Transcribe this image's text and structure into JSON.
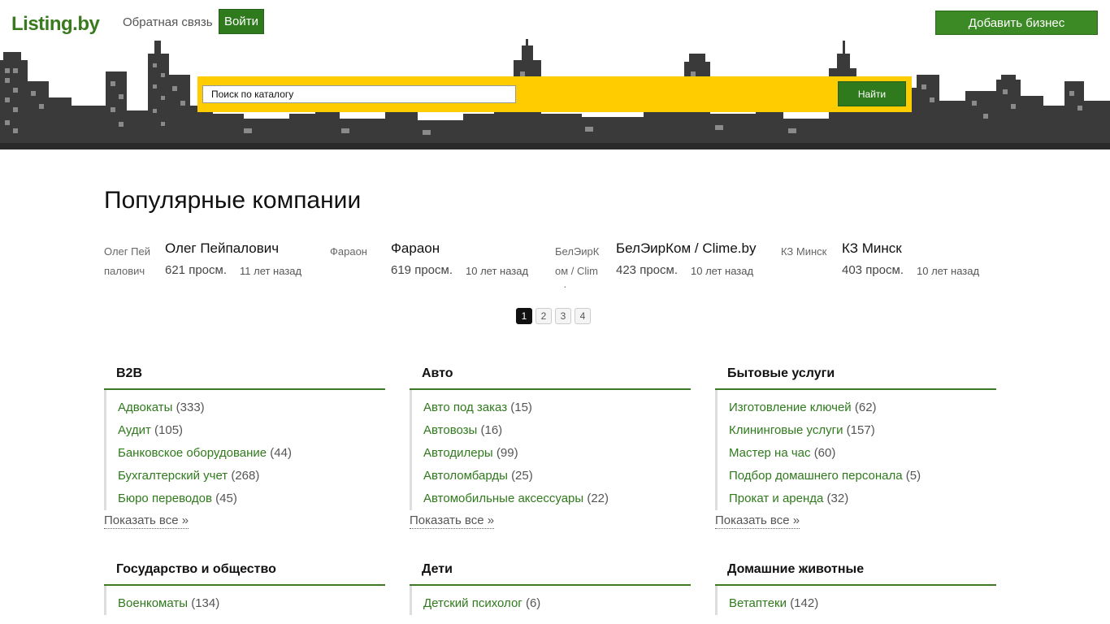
{
  "header": {
    "logo": "Listing.by",
    "feedback": "Обратная связь",
    "login": "Войти",
    "add_business": "Добавить бизнес"
  },
  "search": {
    "value": "Поиск по каталогу",
    "button": "Найти"
  },
  "popular": {
    "title": "Популярные компании",
    "companies": [
      {
        "thumb_alt": "Олег Пейпалович",
        "name": "Олег Пейпалович",
        "views": "621 просм.",
        "age": "11 лет назад"
      },
      {
        "thumb_alt": "Фараон",
        "name": "Фараон",
        "views": "619 просм.",
        "age": "10 лет назад"
      },
      {
        "thumb_alt": "БелЭирКом / Clime.by",
        "name": "БелЭирКом / Clime.by",
        "views": "423 просм.",
        "age": "10 лет назад"
      },
      {
        "thumb_alt": "КЗ Минск",
        "name": "КЗ Минск",
        "views": "403 просм.",
        "age": "10 лет назад"
      }
    ],
    "pages": [
      "1",
      "2",
      "3",
      "4"
    ],
    "active_page": "1"
  },
  "categories": [
    {
      "title": "B2B",
      "more": "Показать все »",
      "items": [
        {
          "label": "Адвокаты",
          "count": "(333)"
        },
        {
          "label": "Аудит",
          "count": "(105)"
        },
        {
          "label": "Банковское оборудование",
          "count": "(44)"
        },
        {
          "label": "Бухгалтерский учет",
          "count": "(268)"
        },
        {
          "label": "Бюро переводов",
          "count": "(45)"
        }
      ]
    },
    {
      "title": "Авто",
      "more": "Показать все »",
      "items": [
        {
          "label": "Авто под заказ",
          "count": "(15)"
        },
        {
          "label": "Автовозы",
          "count": "(16)"
        },
        {
          "label": "Автодилеры",
          "count": "(99)"
        },
        {
          "label": "Автоломбарды",
          "count": "(25)"
        },
        {
          "label": "Автомобильные аксессуары",
          "count": "(22)"
        }
      ]
    },
    {
      "title": "Бытовые услуги",
      "more": "Показать все »",
      "items": [
        {
          "label": "Изготовление ключей",
          "count": "(62)"
        },
        {
          "label": "Клининговые услуги",
          "count": "(157)"
        },
        {
          "label": "Мастер на час",
          "count": "(60)"
        },
        {
          "label": "Подбор домашнего персонала",
          "count": "(5)"
        },
        {
          "label": "Прокат и аренда",
          "count": "(32)"
        }
      ]
    },
    {
      "title": "Государство и общество",
      "items": [
        {
          "label": "Военкоматы",
          "count": "(134)"
        }
      ]
    },
    {
      "title": "Дети",
      "items": [
        {
          "label": "Детский психолог",
          "count": "(6)"
        }
      ]
    },
    {
      "title": "Домашние животные",
      "items": [
        {
          "label": "Ветаптеки",
          "count": "(142)"
        }
      ]
    }
  ],
  "colors": {
    "brand_green": "#3c8a26",
    "search_yellow": "#ffcc00",
    "skyline_dark": "#2a2a2a"
  }
}
